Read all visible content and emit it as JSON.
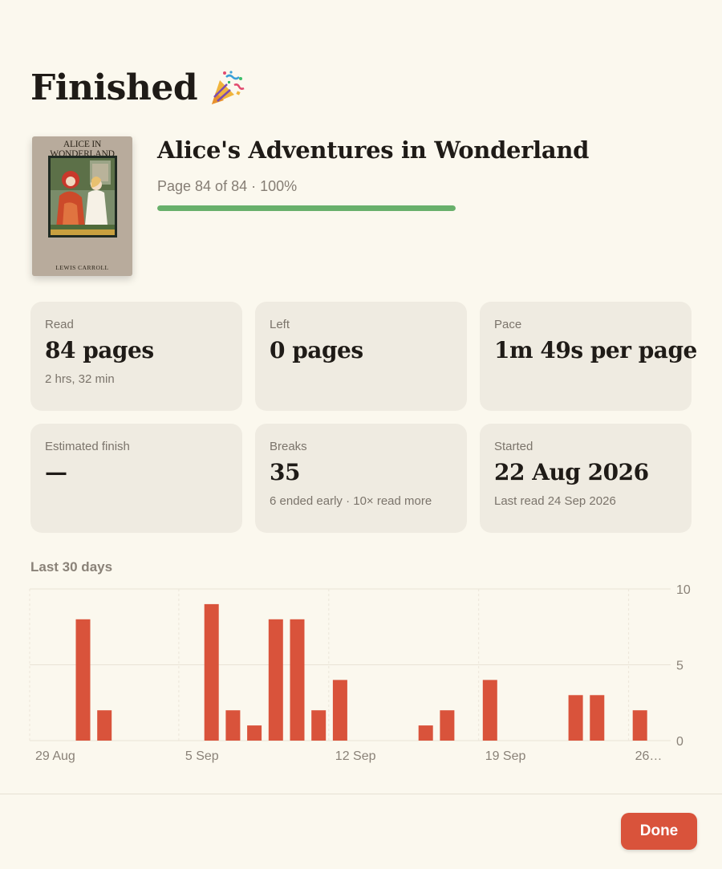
{
  "header": {
    "title": "Finished",
    "icon": "party-popper-icon"
  },
  "book": {
    "title": "Alice's Adventures in Wonderland",
    "progress_text": "Page 84 of 84 · 100%",
    "progress": 1.0,
    "progress_color": "#68b06b",
    "cover": {
      "title": "ALICE IN WONDERLAND",
      "author": "LEWIS CARROLL"
    }
  },
  "stats": [
    {
      "label": "Read",
      "value": "84 pages",
      "sub": "2 hrs, 32 min"
    },
    {
      "label": "Left",
      "value": "0 pages",
      "sub": ""
    },
    {
      "label": "Pace",
      "value": "1m 49s per page",
      "sub": ""
    },
    {
      "label": "Estimated finish",
      "value": "—",
      "sub": ""
    },
    {
      "label": "Breaks",
      "value": "35",
      "sub": "6 ended early · 10× read more"
    },
    {
      "label": "Started",
      "value": "22 Aug 2026",
      "sub": "Last read 24 Sep 2026"
    }
  ],
  "chart_section": {
    "label": "Last 30 days"
  },
  "chart_data": {
    "type": "bar",
    "title": "",
    "xlabel": "",
    "ylabel": "",
    "color": "#d9533b",
    "ylim": [
      0,
      10
    ],
    "yticks": [
      "10",
      "5",
      "0"
    ],
    "ytick_values": [
      10,
      5,
      0
    ],
    "xtick_labels": [
      "29 Aug",
      "5 Sep",
      "12 Sep",
      "19 Sep",
      "26…"
    ],
    "xtick_day_index": [
      0,
      7,
      14,
      21,
      28
    ],
    "categories": [
      "28 Aug",
      "29 Aug",
      "30 Aug",
      "31 Aug",
      "1 Sep",
      "2 Sep",
      "3 Sep",
      "4 Sep",
      "5 Sep",
      "6 Sep",
      "7 Sep",
      "8 Sep",
      "9 Sep",
      "10 Sep",
      "11 Sep",
      "12 Sep",
      "13 Sep",
      "14 Sep",
      "15 Sep",
      "16 Sep",
      "17 Sep",
      "18 Sep",
      "19 Sep",
      "20 Sep",
      "21 Sep",
      "22 Sep",
      "23 Sep",
      "24 Sep",
      "25 Sep",
      "26 Sep"
    ],
    "values": [
      0,
      8,
      2,
      0,
      0,
      0,
      0,
      9,
      2,
      1,
      8,
      8,
      2,
      4,
      0,
      0,
      0,
      1,
      2,
      0,
      4,
      0,
      0,
      0,
      3,
      3,
      0,
      2,
      0,
      0
    ]
  },
  "footer": {
    "done_label": "Done"
  }
}
